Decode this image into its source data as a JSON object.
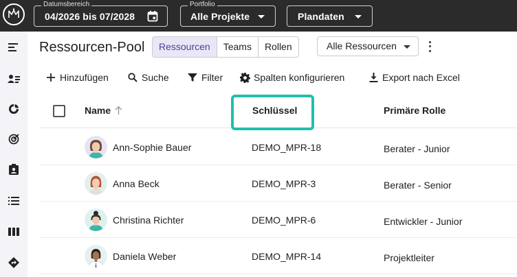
{
  "topbar": {
    "date_range": {
      "legend": "Datumsbereich",
      "value": "04/2026 bis 07/2028"
    },
    "portfolio": {
      "legend": "Portfolio",
      "value": "Alle Projekte"
    },
    "dataset": {
      "value": "Plandaten"
    }
  },
  "page": {
    "title": "Ressourcen-Pool",
    "tabs": [
      {
        "label": "Ressourcen",
        "active": true
      },
      {
        "label": "Teams",
        "active": false
      },
      {
        "label": "Rollen",
        "active": false
      }
    ],
    "resource_filter": "Alle Ressourcen"
  },
  "toolbar": {
    "add": "Hinzufügen",
    "search": "Suche",
    "filter": "Filter",
    "columns": "Spalten konfigurieren",
    "export": "Export nach Excel"
  },
  "table": {
    "columns": {
      "name": "Name",
      "key": "Schlüssel",
      "role": "Primäre Rolle"
    },
    "rows": [
      {
        "name": "Ann-Sophie Bauer",
        "key": "DEMO_MPR-18",
        "role": "Berater - Junior"
      },
      {
        "name": "Anna Beck",
        "key": "DEMO_MPR-3",
        "role": "Berater - Senior"
      },
      {
        "name": "Christina Richter",
        "key": "DEMO_MPR-6",
        "role": "Entwickler - Junior"
      },
      {
        "name": "Daniela Weber",
        "key": "DEMO_MPR-14",
        "role": "Projektleiter"
      }
    ]
  },
  "colors": {
    "accent": "#4e3e9a",
    "highlight": "#1fbfad",
    "topbar": "#2b2b2b"
  }
}
